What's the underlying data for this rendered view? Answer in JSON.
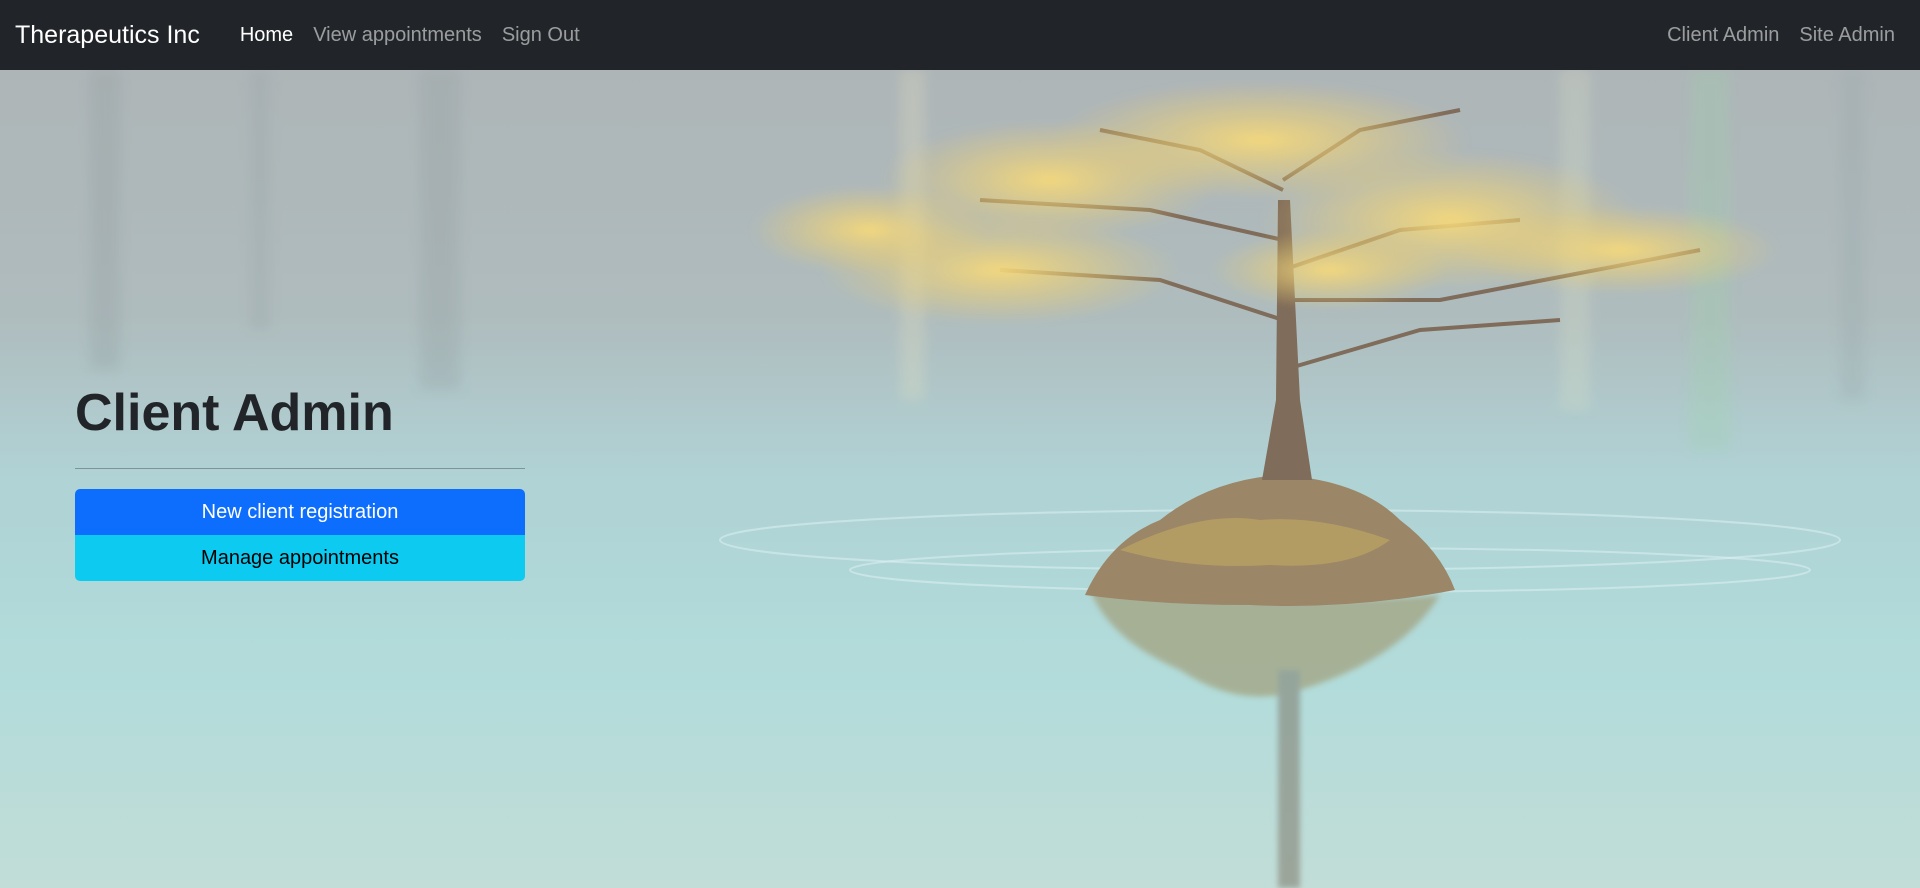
{
  "navbar": {
    "brand": "Therapeutics Inc",
    "left_links": [
      {
        "label": "Home",
        "active": true
      },
      {
        "label": "View appointments",
        "active": false
      },
      {
        "label": "Sign Out",
        "active": false
      }
    ],
    "right_links": [
      {
        "label": "Client Admin"
      },
      {
        "label": "Site Admin"
      }
    ]
  },
  "hero": {
    "background_image": "tree-on-island-in-lake"
  },
  "panel": {
    "title": "Client Admin",
    "buttons": [
      {
        "label": "New client registration",
        "color": "#0d6efd"
      },
      {
        "label": "Manage appointments",
        "color": "#0dcaf0"
      }
    ]
  },
  "colors": {
    "navbar_bg": "#212529",
    "primary": "#0d6efd",
    "info": "#0dcaf0"
  }
}
